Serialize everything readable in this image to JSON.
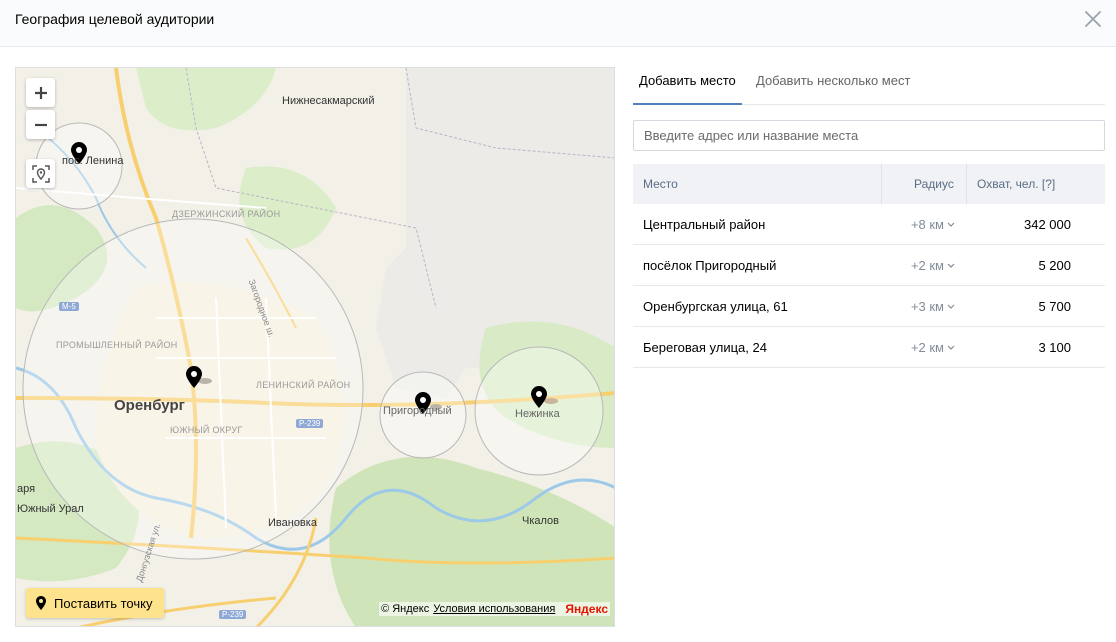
{
  "header": {
    "title": "География целевой аудитории"
  },
  "map": {
    "labels": {
      "nizhnesakmarsky": "Нижнесакмарский",
      "pos_lenina": "пос. Ленина",
      "dzerzhinsky": "ДЗЕРЖИНСКИЙ РАЙОН",
      "zagorodnoe": "Загородное ш.",
      "m5": "М-5",
      "promyshlenny": "ПРОМЫШЛЕННЫЙ РАЙОН",
      "orenburg": "Оренбург",
      "leninsky": "ЛЕНИНСКИЙ РАЙОН",
      "yuzhny": "ЮЖНЫЙ ОКРУГ",
      "r239_a": "Р-239",
      "prigorodny": "Пригородный",
      "nezhinka": "Нежинка",
      "arya": "аря",
      "yuzhny_ural": "Южный Урал",
      "ivanovka": "Ивановка",
      "chkalov": "Чкалов",
      "donguzskaya": "Донгузская ул.",
      "r239_b": "Р-239"
    },
    "place_point_label": "Поставить точку",
    "copyright": "© Яндекс",
    "terms": "Условия использования",
    "logo": "Яндекс"
  },
  "tabs": [
    {
      "label": "Добавить место",
      "active": true
    },
    {
      "label": "Добавить несколько мест",
      "active": false
    }
  ],
  "search": {
    "placeholder": "Введите адрес или название места"
  },
  "table": {
    "headers": {
      "place": "Место",
      "radius": "Радиус",
      "reach": "Охват, чел. [?]"
    },
    "rows": [
      {
        "name": "Центральный район",
        "radius": "+8 км",
        "reach": "342 000"
      },
      {
        "name": "посёлок Пригородный",
        "radius": "+2 км",
        "reach": "5 200"
      },
      {
        "name": "Оренбургская улица, 61",
        "radius": "+3 км",
        "reach": "5 700"
      },
      {
        "name": "Береговая улица, 24",
        "radius": "+2 км",
        "reach": "3 100"
      }
    ]
  },
  "colors": {
    "accent": "#5181b8",
    "header_bg": "#fafbfc",
    "place_button": "#ffe28c",
    "table_header_bg": "#f0f2f5"
  }
}
